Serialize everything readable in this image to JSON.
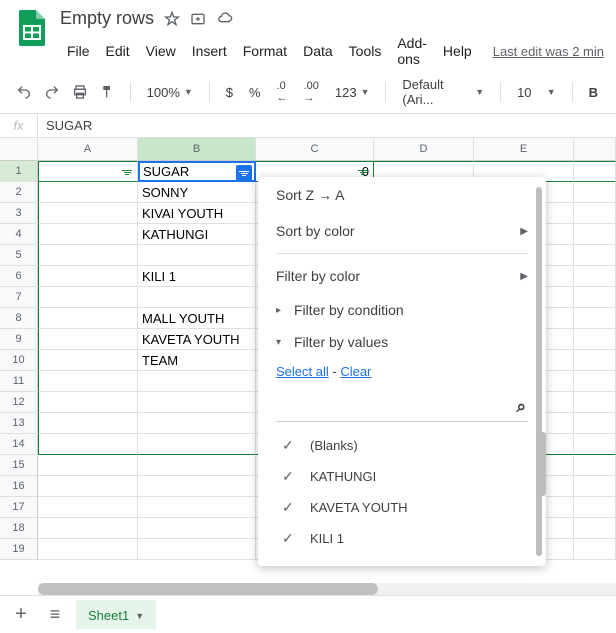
{
  "doc": {
    "title": "Empty rows"
  },
  "menu": {
    "file": "File",
    "edit": "Edit",
    "view": "View",
    "insert": "Insert",
    "format": "Format",
    "data": "Data",
    "tools": "Tools",
    "addons": "Add-ons",
    "help": "Help",
    "last_edit": "Last edit was 2 min"
  },
  "toolbar": {
    "zoom": "100%",
    "font": "Default (Ari...",
    "font_size": "10",
    "currency": "$",
    "percent": "%",
    "dec_dec": ".0",
    "dec_inc": ".00",
    "num_format": "123",
    "bold": "B"
  },
  "formula": {
    "label": "fx",
    "value": "SUGAR"
  },
  "columns": [
    "A",
    "B",
    "C",
    "D",
    "E"
  ],
  "rows": [
    {
      "n": 1,
      "A": "",
      "B": "SUGAR",
      "C": "0"
    },
    {
      "n": 2,
      "A": "",
      "B": "SONNY",
      "C": ""
    },
    {
      "n": 3,
      "A": "",
      "B": "KIVAI YOUTH",
      "C": ""
    },
    {
      "n": 4,
      "A": "",
      "B": "KATHUNGI",
      "C": ""
    },
    {
      "n": 5,
      "A": "",
      "B": "",
      "C": ""
    },
    {
      "n": 6,
      "A": "",
      "B": "KILI 1",
      "C": ""
    },
    {
      "n": 7,
      "A": "",
      "B": "",
      "C": ""
    },
    {
      "n": 8,
      "A": "",
      "B": "MALL YOUTH",
      "C": ""
    },
    {
      "n": 9,
      "A": "",
      "B": "KAVETA YOUTH",
      "C": ""
    },
    {
      "n": 10,
      "A": "",
      "B": "TEAM",
      "C": ""
    },
    {
      "n": 11
    },
    {
      "n": 12
    },
    {
      "n": 13
    },
    {
      "n": 14
    },
    {
      "n": 15
    },
    {
      "n": 16
    },
    {
      "n": 17
    },
    {
      "n": 18
    },
    {
      "n": 19
    }
  ],
  "active_cell": "B1",
  "filter": {
    "sort_za": "Sort Z → A",
    "sort_color": "Sort by color",
    "filter_color": "Filter by color",
    "filter_cond": "Filter by condition",
    "filter_vals": "Filter by values",
    "select_all": "Select all",
    "clear": "Clear",
    "sep": " - ",
    "values": [
      "(Blanks)",
      "KATHUNGI",
      "KAVETA YOUTH",
      "KILI 1"
    ]
  },
  "sheet": {
    "name": "Sheet1"
  },
  "icons": {
    "plus": "+",
    "menu": "≡",
    "check": "✓",
    "search": "⌕"
  }
}
